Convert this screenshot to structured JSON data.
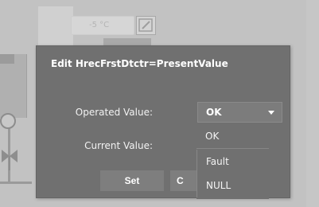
{
  "background": {
    "temperature_readout": "-5 °C",
    "edit_icon": "pencil-square-icon"
  },
  "dialog": {
    "title": "Edit HrecFrstDtctr=PresentValue",
    "operated_value_label": "Operated Value:",
    "current_value_label": "Current Value:",
    "selected_value": "OK",
    "dropdown_arrow_icon": "chevron-down-icon",
    "options": [
      "OK",
      "Fault",
      "NULL"
    ],
    "set_button": "Set",
    "cancel_button_visible": "C"
  },
  "colors": {
    "dialog_bg": "#707070",
    "select_bg": "#7c7c7c",
    "button_bg": "#7e7e7e",
    "text": "#ffffff",
    "backdrop": "#c2c2c2"
  }
}
